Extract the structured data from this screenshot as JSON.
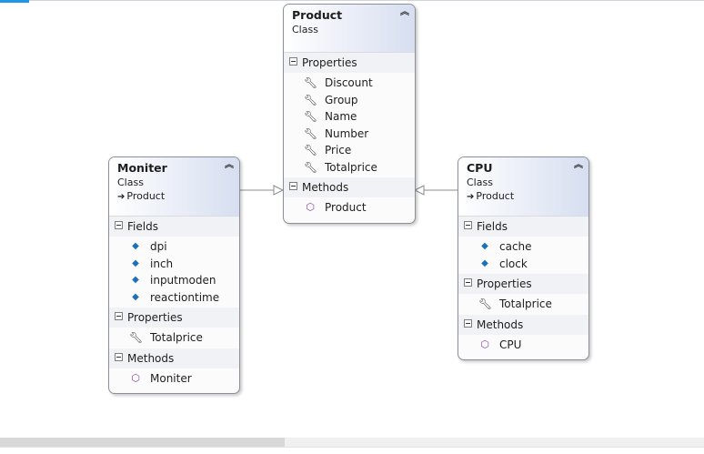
{
  "classes": {
    "product": {
      "name": "Product",
      "kind": "Class",
      "sections": [
        {
          "title": "Properties",
          "items": [
            "Discount",
            "Group",
            "Name",
            "Number",
            "Price",
            "Totalprice"
          ]
        },
        {
          "title": "Methods",
          "items": [
            "Product"
          ]
        }
      ]
    },
    "moniter": {
      "name": "Moniter",
      "kind": "Class",
      "base": "Product",
      "sections": [
        {
          "title": "Fields",
          "items": [
            "dpi",
            "inch",
            "inputmoden",
            "reactiontime"
          ]
        },
        {
          "title": "Properties",
          "items": [
            "Totalprice"
          ]
        },
        {
          "title": "Methods",
          "items": [
            "Moniter"
          ]
        }
      ]
    },
    "cpu": {
      "name": "CPU",
      "kind": "Class",
      "base": "Product",
      "sections": [
        {
          "title": "Fields",
          "items": [
            "cache",
            "clock"
          ]
        },
        {
          "title": "Properties",
          "items": [
            "Totalprice"
          ]
        },
        {
          "title": "Methods",
          "items": [
            "CPU"
          ]
        }
      ]
    }
  },
  "icons": {
    "property": "wrench-icon",
    "field": "field-icon",
    "method": "method-icon",
    "collapse": "double-chevron-up-icon",
    "base_arrow": "arrow-right-icon"
  },
  "colors": {
    "header_gradient_end": "#d6def0",
    "border": "#8a8f98",
    "field_icon": "#1d6fb8",
    "method_icon": "#8b3fb8",
    "connector": "#8c8c8c"
  }
}
